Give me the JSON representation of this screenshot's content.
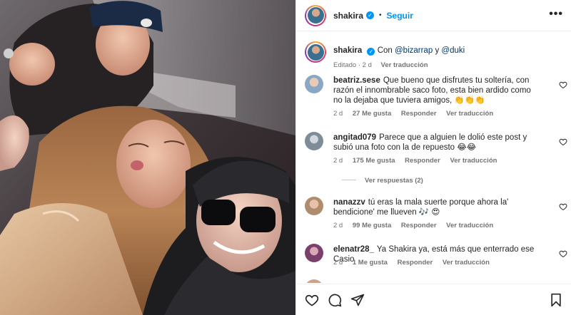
{
  "post": {
    "username": "shakira",
    "follow_label": "Seguir",
    "dot": "•",
    "more_label": "•••"
  },
  "caption": {
    "username": "shakira",
    "text_prefix": "Con",
    "mention1": "@bizarrap",
    "conj": "y",
    "mention2": "@duki",
    "edited": "Editado · 2 d",
    "translate": "Ver traducción"
  },
  "comments": [
    {
      "user": "beatriz.sese",
      "text": "Que bueno que disfrutes tu soltería, con razón el innombrable saco foto, esta bien ardido como no la dejaba que tuviera amigos, 👏👏👏",
      "time": "2 d",
      "likes": "27 Me gusta",
      "reply": "Responder",
      "translate": "Ver traducción"
    },
    {
      "user": "angitad079",
      "text": "Parece que a alguien le dolió este post y subió una foto con la de repuesto 😂😂",
      "time": "2 d",
      "likes": "175 Me gusta",
      "reply": "Responder",
      "translate": "Ver traducción",
      "view_replies": "Ver respuestas (2)"
    },
    {
      "user": "nanazzv",
      "text": "tú eras la mala suerte porque ahora la' bendicione' me llueven 🎶 😍",
      "time": "2 d",
      "likes": "99 Me gusta",
      "reply": "Responder",
      "translate": "Ver traducción"
    },
    {
      "user": "elenatr28_",
      "text": "Ya Shakira ya, está más que enterrado ese Casio",
      "time": "2 d",
      "likes": "1 Me gusta",
      "reply": "Responder",
      "translate": "Ver traducción"
    }
  ],
  "icons": {
    "like": "heart-icon",
    "comment": "comment-icon",
    "share": "share-icon",
    "save": "bookmark-icon",
    "verified": "verified-badge-icon"
  },
  "colors": {
    "accent": "#0095f6",
    "mention": "#00376b",
    "secondary_text": "#737373"
  }
}
